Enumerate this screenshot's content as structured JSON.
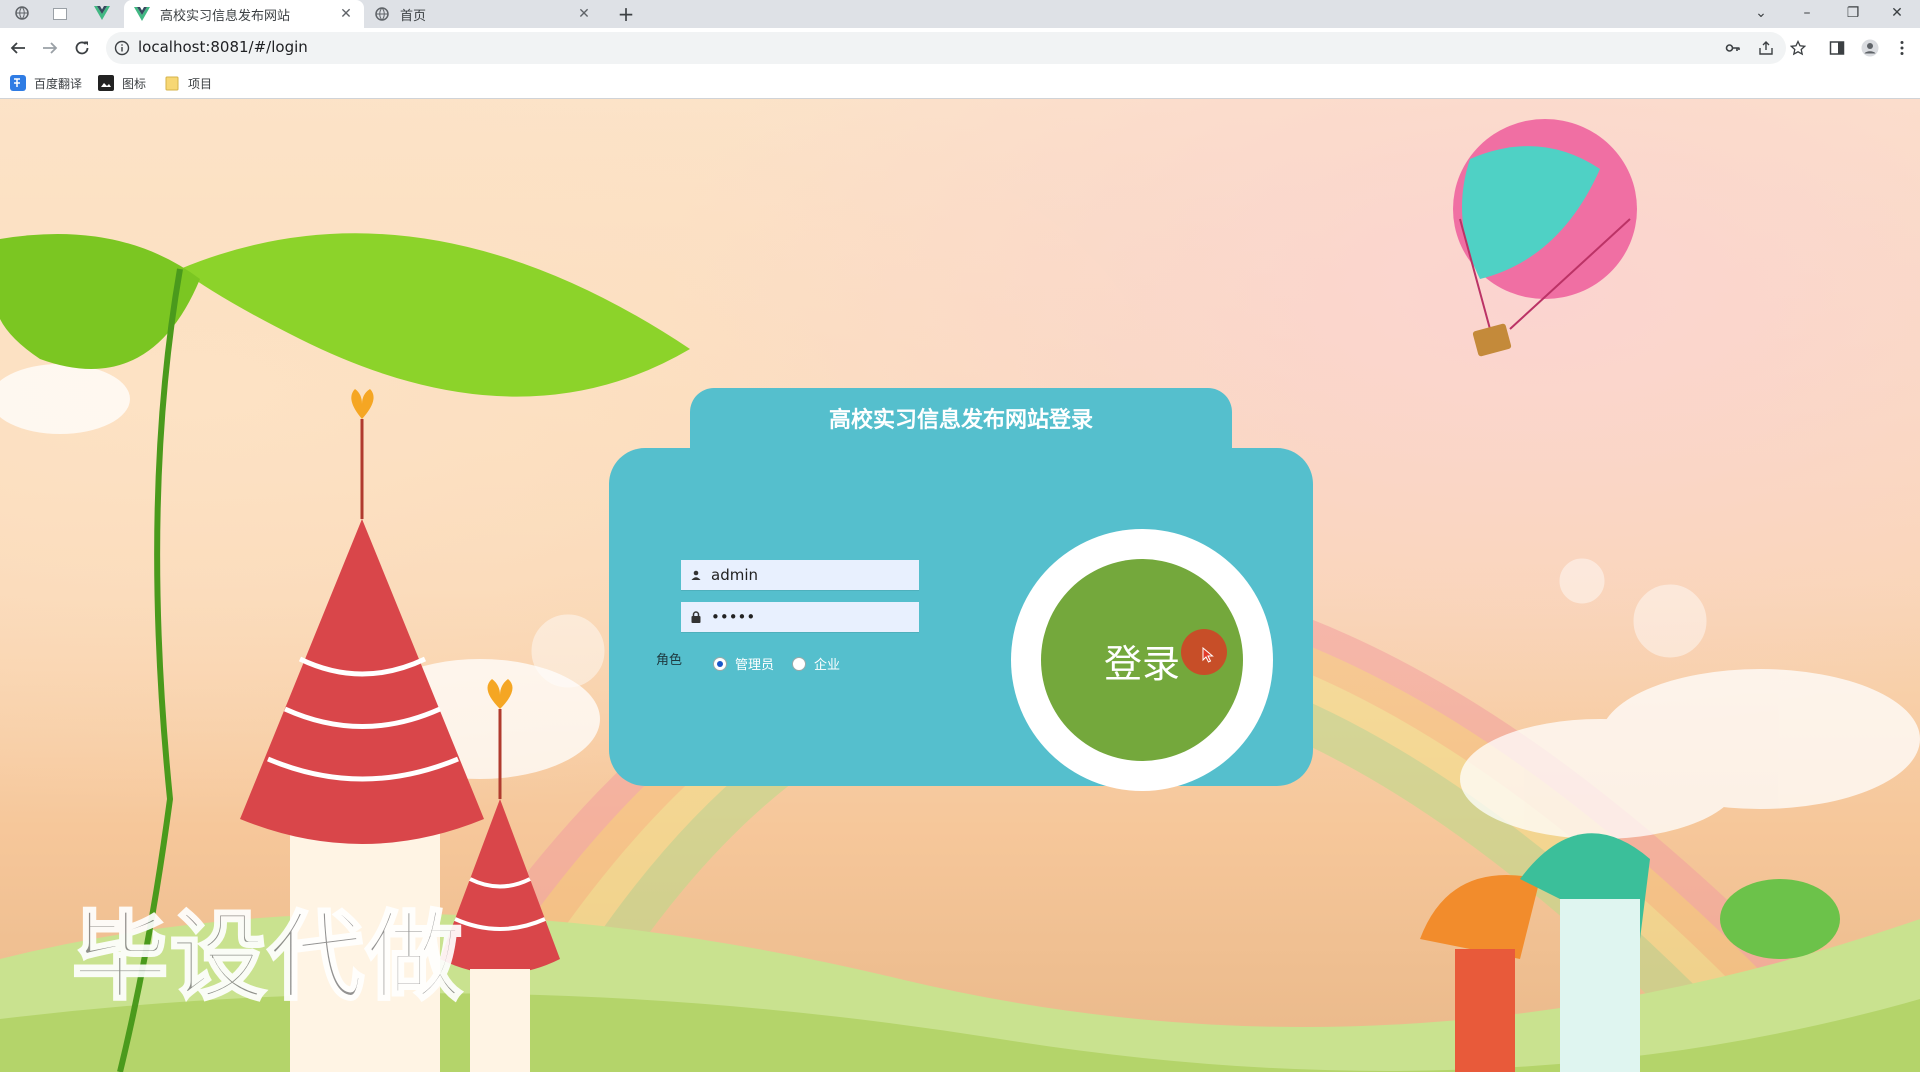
{
  "browser": {
    "tabs": [
      {
        "title": "高校实习信息发布网站",
        "active": true
      },
      {
        "title": "首页",
        "active": false
      }
    ],
    "url": "localhost:8081/#/login",
    "bookmarks": [
      "百度翻译",
      "图标",
      "项目"
    ]
  },
  "login": {
    "title": "高校实习信息发布网站登录",
    "username": "admin",
    "password": "•••••",
    "role_label": "角色",
    "roles": [
      "管理员",
      "企业"
    ],
    "selected_role": "管理员",
    "submit_label": "登录"
  },
  "watermark": "毕设代做",
  "colors": {
    "card": "#55bfcd",
    "login_button": "#74a83c",
    "cursor": "#d63e24"
  }
}
